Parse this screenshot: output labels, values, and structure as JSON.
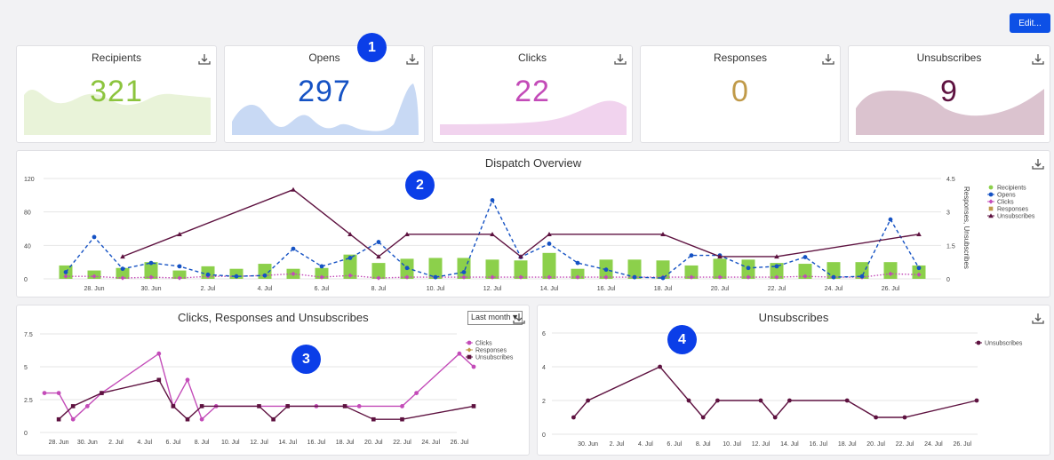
{
  "toolbar": {
    "edit_label": "Edit..."
  },
  "kpis": [
    {
      "title": "Recipients",
      "value": "321",
      "color": "#8cc43e",
      "fill": "#e9f3d9"
    },
    {
      "title": "Opens",
      "value": "297",
      "color": "#1552c4",
      "fill": "#c8d9f4"
    },
    {
      "title": "Clicks",
      "value": "22",
      "color": "#c34bb8",
      "fill": "#f1d3ee"
    },
    {
      "title": "Responses",
      "value": "0",
      "color": "#c09a49",
      "fill": "#ffffff"
    },
    {
      "title": "Unsubscribes",
      "value": "9",
      "color": "#5e1240",
      "fill": "#dbc3cf"
    }
  ],
  "badges": [
    "1",
    "2",
    "3",
    "4"
  ],
  "colors": {
    "recipients": "#8cd04b",
    "opens": "#1552c4",
    "clicks": "#c34bb8",
    "responses": "#c09a49",
    "unsubscribes": "#5e1240",
    "accent": "#0d50e6"
  },
  "icons": {
    "download": "download-icon",
    "dropdown": "chevron-down-icon"
  },
  "overview": {
    "title": "Dispatch Overview",
    "right_axis_label": "Responses, Unsubscribes"
  },
  "bottom_left": {
    "title": "Clicks, Responses and Unsubscribes",
    "period_select": "Last month"
  },
  "bottom_right": {
    "title": "Unsubscribes"
  },
  "chart_data": [
    {
      "type": "bar",
      "title": "Dispatch Overview",
      "x": [
        "27. Jun",
        "28. Jun",
        "29. Jun",
        "30. Jun",
        "1. Jul",
        "2. Jul",
        "3. Jul",
        "4. Jul",
        "5. Jul",
        "6. Jul",
        "7. Jul",
        "8. Jul",
        "9. Jul",
        "10. Jul",
        "11. Jul",
        "12. Jul",
        "13. Jul",
        "14. Jul",
        "15. Jul",
        "16. Jul",
        "17. Jul",
        "18. Jul",
        "19. Jul",
        "20. Jul",
        "21. Jul",
        "22. Jul",
        "23. Jul",
        "24. Jul",
        "25. Jul",
        "26. Jul",
        "27. Jul"
      ],
      "x_tick_labels": [
        "28. Jun",
        "30. Jun",
        "2. Jul",
        "4. Jul",
        "6. Jul",
        "8. Jul",
        "10. Jul",
        "12. Jul",
        "14. Jul",
        "16. Jul",
        "18. Jul",
        "20. Jul",
        "22. Jul",
        "24. Jul",
        "26. Jul"
      ],
      "y_left_ticks": [
        "0",
        "40",
        "80",
        "120"
      ],
      "y_left_lim": [
        0,
        120
      ],
      "y_right_ticks": [
        "0",
        "1.5",
        "3",
        "4.5"
      ],
      "y_right_lim": [
        0,
        4.5
      ],
      "y_right_label": "Responses, Unsubscribes",
      "legend": "right",
      "series": [
        {
          "name": "Recipients",
          "type": "bar",
          "axis": "left",
          "values": [
            16,
            10,
            13,
            20,
            10,
            15,
            12,
            18,
            12,
            13,
            29,
            19,
            24,
            25,
            25,
            23,
            22,
            31,
            12,
            23,
            23,
            22,
            16,
            24,
            23,
            19,
            18,
            20,
            20,
            20,
            16
          ]
        },
        {
          "name": "Opens",
          "type": "line",
          "axis": "left",
          "values": [
            8,
            50,
            12,
            19,
            15,
            5,
            3,
            4,
            36,
            15,
            25,
            44,
            13,
            2,
            8,
            94,
            26,
            42,
            19,
            11,
            2,
            1,
            28,
            28,
            13,
            15,
            26,
            2,
            3,
            71,
            13
          ]
        },
        {
          "name": "Clicks",
          "type": "line",
          "axis": "left",
          "values": [
            3,
            3,
            1,
            2,
            1,
            3,
            3,
            4,
            6,
            2,
            4,
            1,
            2,
            2,
            2,
            2,
            2,
            2,
            2,
            2,
            2,
            2,
            2,
            2,
            2,
            2,
            3,
            2,
            2,
            6,
            5
          ]
        },
        {
          "name": "Responses",
          "type": "line",
          "axis": "right",
          "values": []
        },
        {
          "name": "Unsubscribes",
          "type": "line",
          "axis": "right",
          "x": [
            "29. Jun",
            "1. Jul",
            "5. Jul",
            "7. Jul",
            "8. Jul",
            "9. Jul",
            "12. Jul",
            "13. Jul",
            "14. Jul",
            "18. Jul",
            "20. Jul",
            "22. Jul",
            "27. Jul"
          ],
          "values": [
            1,
            2,
            4,
            2,
            1,
            2,
            2,
            1,
            2,
            2,
            1,
            1,
            2
          ]
        }
      ]
    },
    {
      "type": "line",
      "title": "Clicks, Responses and Unsubscribes",
      "x_tick_labels": [
        "28. Jun",
        "30. Jun",
        "2. Jul",
        "4. Jul",
        "6. Jul",
        "8. Jul",
        "10. Jul",
        "12. Jul",
        "14. Jul",
        "16. Jul",
        "18. Jul",
        "20. Jul",
        "22. Jul",
        "24. Jul",
        "26. Jul"
      ],
      "y_ticks": [
        "0",
        "2.5",
        "5",
        "7.5"
      ],
      "ylim": [
        0,
        7.5
      ],
      "legend": "right",
      "series": [
        {
          "name": "Clicks",
          "x": [
            "27. Jun",
            "28. Jun",
            "29. Jun",
            "30. Jun",
            "1. Jul",
            "5. Jul",
            "6. Jul",
            "7. Jul",
            "8. Jul",
            "9. Jul",
            "14. Jul",
            "16. Jul",
            "19. Jul",
            "22. Jul",
            "23. Jul",
            "26. Jul",
            "27. Jul"
          ],
          "values": [
            3,
            3,
            1,
            2,
            3,
            6,
            2,
            4,
            1,
            2,
            2,
            2,
            2,
            2,
            3,
            6,
            5
          ]
        },
        {
          "name": "Responses",
          "x": [],
          "values": []
        },
        {
          "name": "Unsubscribes",
          "x": [
            "28. Jun",
            "29. Jun",
            "1. Jul",
            "5. Jul",
            "6. Jul",
            "7. Jul",
            "8. Jul",
            "12. Jul",
            "13. Jul",
            "14. Jul",
            "18. Jul",
            "20. Jul",
            "22. Jul",
            "27. Jul"
          ],
          "values": [
            1,
            2,
            3,
            4,
            2,
            1,
            2,
            2,
            1,
            2,
            2,
            1,
            1,
            2
          ]
        }
      ]
    },
    {
      "type": "line",
      "title": "Unsubscribes",
      "x_tick_labels": [
        "30. Jun",
        "2. Jul",
        "4. Jul",
        "6. Jul",
        "8. Jul",
        "10. Jul",
        "12. Jul",
        "14. Jul",
        "16. Jul",
        "18. Jul",
        "20. Jul",
        "22. Jul",
        "24. Jul",
        "26. Jul"
      ],
      "y_ticks": [
        "0",
        "2",
        "4",
        "6"
      ],
      "ylim": [
        0,
        6
      ],
      "legend": "right",
      "series": [
        {
          "name": "Unsubscribes",
          "x": [
            "29. Jun",
            "30. Jun",
            "5. Jul",
            "7. Jul",
            "8. Jul",
            "9. Jul",
            "12. Jul",
            "13. Jul",
            "14. Jul",
            "18. Jul",
            "20. Jul",
            "22. Jul",
            "27. Jul"
          ],
          "values": [
            1,
            2,
            4,
            2,
            1,
            2,
            2,
            1,
            2,
            2,
            1,
            1,
            2
          ]
        }
      ]
    }
  ]
}
